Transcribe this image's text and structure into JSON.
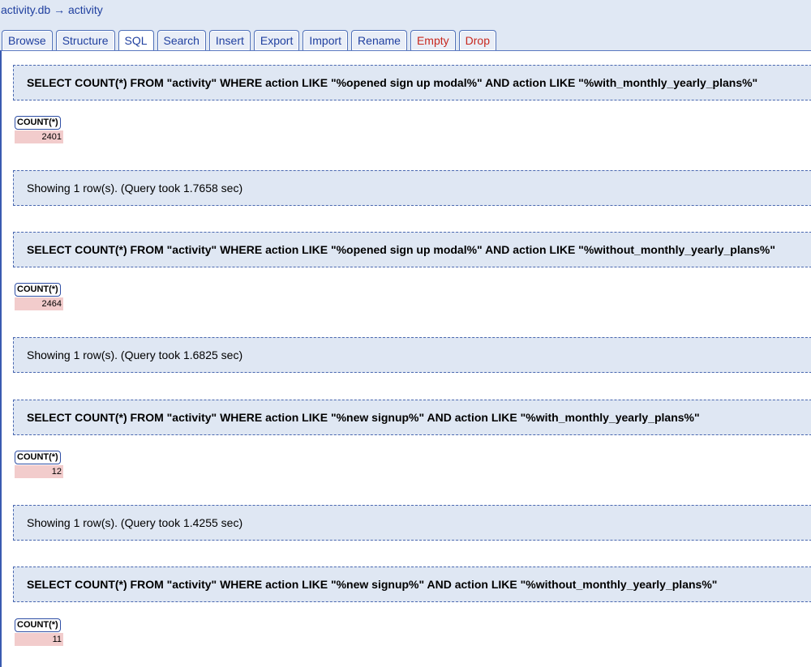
{
  "breadcrumb": {
    "db": "activity.db",
    "arrow": "→",
    "table": "activity"
  },
  "tabs": [
    {
      "label": "Browse"
    },
    {
      "label": "Structure"
    },
    {
      "label": "SQL"
    },
    {
      "label": "Search"
    },
    {
      "label": "Insert"
    },
    {
      "label": "Export"
    },
    {
      "label": "Import"
    },
    {
      "label": "Rename"
    },
    {
      "label": "Empty"
    },
    {
      "label": "Drop"
    }
  ],
  "active_tab": "SQL",
  "results": [
    {
      "query": "SELECT COUNT(*) FROM \"activity\" WHERE action LIKE \"%opened sign up modal%\" AND action LIKE \"%with_monthly_yearly_plans%\"",
      "column": "COUNT(*)",
      "value": "2401",
      "status": "Showing 1 row(s). (Query took 1.7658 sec)"
    },
    {
      "query": "SELECT COUNT(*) FROM \"activity\" WHERE action LIKE \"%opened sign up modal%\" AND action LIKE \"%without_monthly_yearly_plans%\"",
      "column": "COUNT(*)",
      "value": "2464",
      "status": "Showing 1 row(s). (Query took 1.6825 sec)"
    },
    {
      "query": "SELECT COUNT(*) FROM \"activity\" WHERE action LIKE \"%new signup%\" AND action LIKE \"%with_monthly_yearly_plans%\"",
      "column": "COUNT(*)",
      "value": "12",
      "status": "Showing 1 row(s). (Query took 1.4255 sec)"
    },
    {
      "query": "SELECT COUNT(*) FROM \"activity\" WHERE action LIKE \"%new signup%\" AND action LIKE \"%without_monthly_yearly_plans%\"",
      "column": "COUNT(*)",
      "value": "11"
    }
  ]
}
